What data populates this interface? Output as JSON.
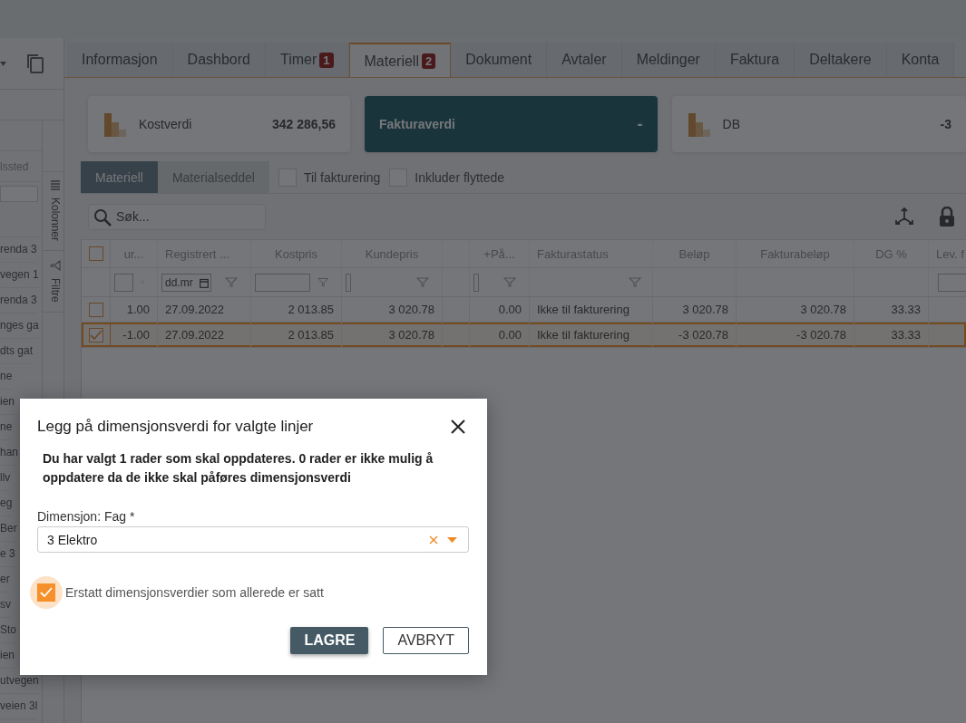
{
  "sidebar": {
    "header": "lssted",
    "rows": [
      "renda 3",
      "vegen 1",
      "renda 3",
      "nges ga",
      "dts gat",
      "ne",
      "ien",
      "ne",
      "han",
      "llv",
      "eg",
      "Ber",
      "e 3",
      "er",
      "sv",
      "Sto",
      "ien",
      "utvegen",
      "veien 3l"
    ],
    "panels": [
      {
        "label": "Kolonner",
        "kind": "columns"
      },
      {
        "label": "Filtre",
        "kind": "filter"
      }
    ]
  },
  "tabs": [
    {
      "label": "Informasjon",
      "selected": false
    },
    {
      "label": "Dashbord",
      "selected": false
    },
    {
      "label": "Timer",
      "badge": "1",
      "selected": false
    },
    {
      "label": "Materiell",
      "badge": "2",
      "selected": true
    },
    {
      "label": "Dokument",
      "selected": false
    },
    {
      "label": "Avtaler",
      "selected": false
    },
    {
      "label": "Meldinger",
      "selected": false
    },
    {
      "label": "Faktura",
      "selected": false
    },
    {
      "label": "Deltakere",
      "selected": false
    },
    {
      "label": "Konta",
      "selected": false
    }
  ],
  "summary_cards": [
    {
      "label": "Kostverdi",
      "value": "342 286,56",
      "kind": "stat"
    },
    {
      "label": "Fakturaverdi",
      "value": "-",
      "kind": "highlight"
    },
    {
      "label": "DB",
      "value": "-3",
      "kind": "stat"
    }
  ],
  "subtabs": [
    {
      "label": "Materiell",
      "selected": true
    },
    {
      "label": "Materialseddel",
      "selected": false
    }
  ],
  "options": [
    {
      "label": "Til fakturering",
      "checked": false
    },
    {
      "label": "Inkluder flyttede",
      "checked": false
    }
  ],
  "search": {
    "placeholder": "Søk..."
  },
  "table": {
    "header_checked": false,
    "columns": [
      {
        "label": "ur...",
        "kind": "number",
        "filter": {
          "kind": "input"
        }
      },
      {
        "label": "Registrert ...",
        "kind": "text",
        "filter": {
          "kind": "date",
          "placeholder": "dd.mr"
        }
      },
      {
        "label": "Kostpris",
        "kind": "number",
        "filter": {
          "kind": "input"
        }
      },
      {
        "label": "Kundepris",
        "kind": "number",
        "filter": {
          "kind": "input"
        }
      },
      {
        "kind": "blank"
      },
      {
        "label": "+På...",
        "kind": "number",
        "filter": {
          "kind": "input"
        }
      },
      {
        "label": "Fakturastatus",
        "kind": "text",
        "filter": {
          "kind": "funnel"
        }
      },
      {
        "label": "Beløp",
        "kind": "number"
      },
      {
        "label": "Fakturabeløp",
        "kind": "number"
      },
      {
        "label": "DG %",
        "kind": "number"
      },
      {
        "label": "Lev. f",
        "kind": "text",
        "filter": {
          "kind": "field"
        }
      }
    ],
    "rows": [
      {
        "checked": false,
        "selected": false,
        "cells": [
          "1.00",
          "27.09.2022",
          "2 013.85",
          "3 020.78",
          null,
          "0.00",
          "Ikke til fakturering",
          "3 020.78",
          "3 020.78",
          "33.33",
          null
        ]
      },
      {
        "checked": true,
        "selected": true,
        "cells": [
          "-1.00",
          "27.09.2022",
          "2 013.85",
          "3 020.78",
          null,
          "0.00",
          "Ikke til fakturering",
          "-3 020.78",
          "-3 020.78",
          "33.33",
          null
        ]
      }
    ]
  },
  "dialog": {
    "title": "Legg på dimensjonsverdi for valgte linjer",
    "message": "Du har valgt 1 rader som skal oppdateres. 0 rader er ikke mulig å oppdatere da de ikke skal påføres dimensjonsverdi",
    "field": {
      "label": "Dimensjon: Fag *",
      "value": "3 Elektro"
    },
    "replace_option": {
      "label": "Erstatt dimensjonsverdier som allerede er satt",
      "checked": true
    },
    "buttons": [
      {
        "label": "LAGRE",
        "kind": "primary"
      },
      {
        "label": "AVBRYT",
        "kind": "secondary"
      }
    ]
  }
}
